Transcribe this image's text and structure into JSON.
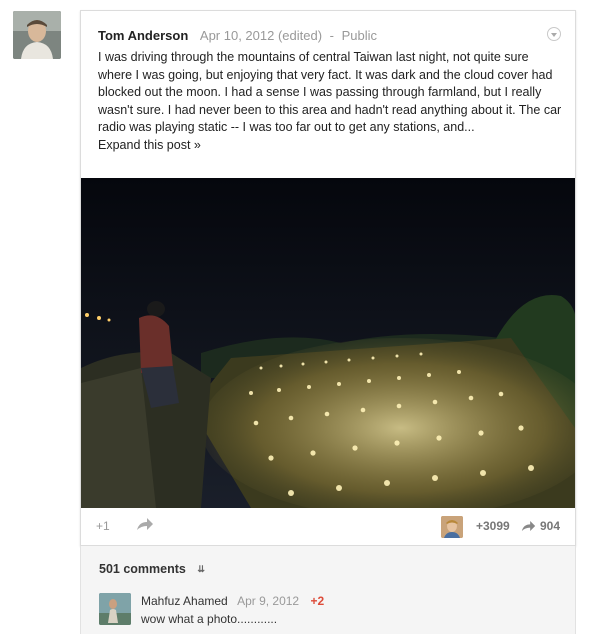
{
  "post": {
    "author": "Tom Anderson",
    "date": "Apr 10, 2012 (edited)",
    "separator": "-",
    "visibility": "Public",
    "text": "I was driving through the mountains of central Taiwan last night, not quite sure where I was going, but enjoying that very fact. It was dark and the cloud cover had blocked out the moon. I had a sense I was passing through farmland, but I really wasn't sure. I had never been to this area and hadn't read anything about it. The car radio was playing static -- I was too far out to get any stations, and...",
    "expand_label": "Expand this post »"
  },
  "actions": {
    "plus_one_label": "+1",
    "plus_count": "+3099",
    "share_count": "904"
  },
  "comments": {
    "count_label": "501 comments",
    "items": [
      {
        "name": "Mahfuz Ahamed",
        "date": "Apr 9, 2012",
        "plus": "+2",
        "text": "wow what a photo............"
      }
    ]
  },
  "icons": {
    "menu": "chevron-down-circle-icon",
    "share": "share-arrow-icon",
    "expand_comments": "double-chevron-down-icon"
  }
}
